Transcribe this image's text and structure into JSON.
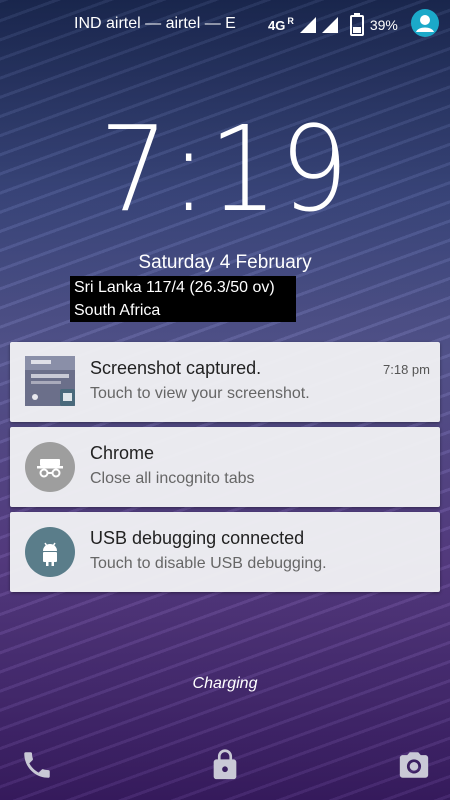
{
  "status_bar": {
    "carrier": "IND airtel — airtel — E",
    "network_type": "4G",
    "roaming": "R",
    "battery_percent": "39%"
  },
  "lockscreen": {
    "time": "7:19",
    "date": "Saturday 4 February",
    "ticker": [
      "Sri Lanka 117/4 (26.3/50 ov)",
      "South Africa"
    ]
  },
  "notifications": [
    {
      "title": "Screenshot captured.",
      "subtitle": "Touch to view your screenshot.",
      "time": "7:18 pm",
      "icon": "screenshot-thumbnail"
    },
    {
      "title": "Chrome",
      "subtitle": "Close all incognito tabs",
      "icon": "incognito-icon",
      "icon_color": "#9e9e9e"
    },
    {
      "title": "USB debugging connected",
      "subtitle": "Touch to disable USB debugging.",
      "icon": "android-icon",
      "icon_color": "#5a7d8a"
    }
  ],
  "charging_text": "Charging",
  "shortcuts": {
    "left": "phone-icon",
    "center": "lock-icon",
    "right": "camera-icon"
  }
}
